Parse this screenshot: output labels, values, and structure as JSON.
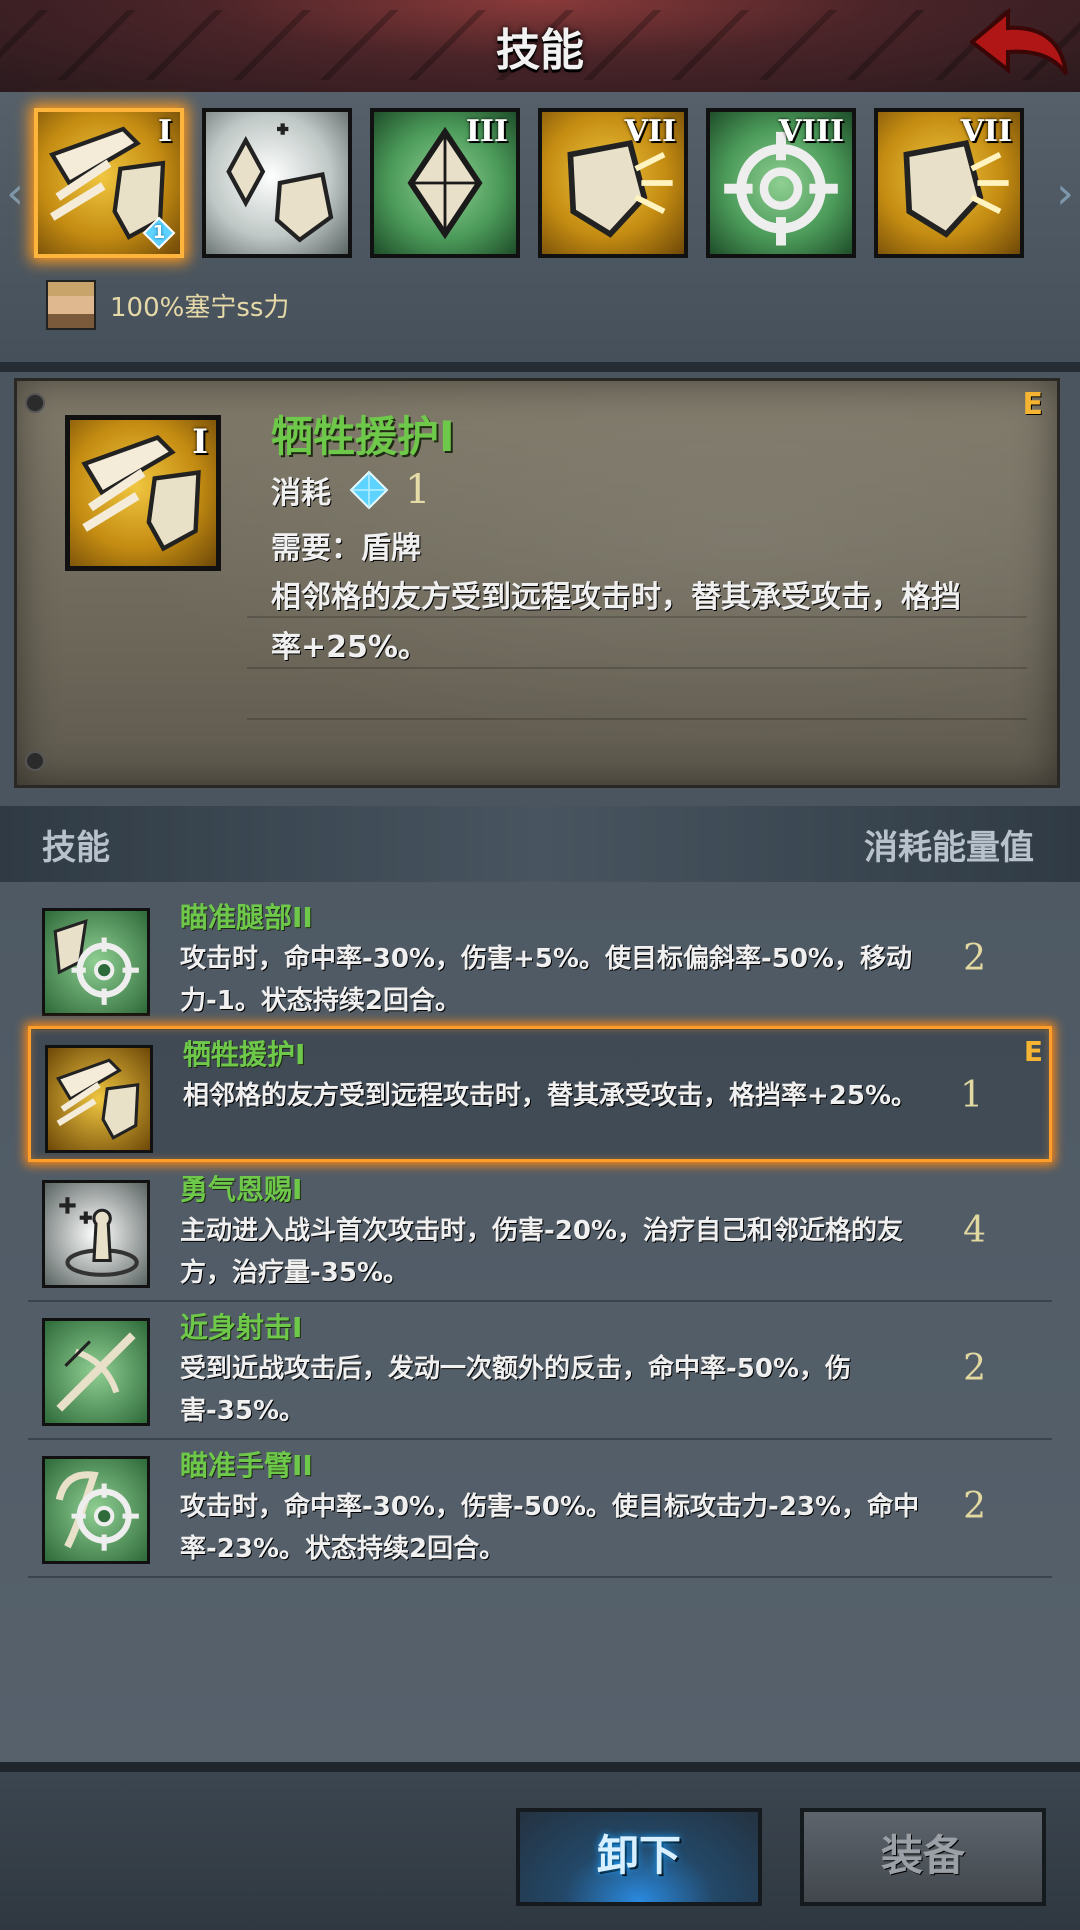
{
  "header": {
    "title": "技能"
  },
  "tray": {
    "slots": [
      {
        "icon": "shield-sacrifice-icon",
        "numeral": "I",
        "badge": "1",
        "style": "gold",
        "selected": true
      },
      {
        "icon": "crystal-shield-icon",
        "numeral": "",
        "style": "white",
        "selected": false
      },
      {
        "icon": "crystal-icon",
        "numeral": "III",
        "style": "green",
        "selected": false
      },
      {
        "icon": "shield-break-icon",
        "numeral": "VII",
        "style": "gold",
        "selected": false
      },
      {
        "icon": "crosshair-icon",
        "numeral": "VIII",
        "style": "green",
        "selected": false
      },
      {
        "icon": "shield-break-icon",
        "numeral": "VII",
        "style": "gold",
        "selected": false
      }
    ],
    "owner_text": "100%塞宁ss力"
  },
  "detail": {
    "name": "牺牲援护I",
    "tier": "E",
    "cost_label": "消耗",
    "cost_value": "1",
    "requirement": "需要：盾牌",
    "description": "相邻格的友方受到远程攻击时，替其承受攻击，格挡率+25%。"
  },
  "list_header": {
    "left": "技能",
    "right": "消耗能量值"
  },
  "skills": [
    {
      "name": "瞄准腿部II",
      "desc": "攻击时，命中率-30%，伤害+5%。使目标偏斜率-50%，移动力-1。状态持续2回合。",
      "cost": "2",
      "tier": "",
      "icon": "aim-leg-icon"
    },
    {
      "name": "牺牲援护I",
      "desc": "相邻格的友方受到远程攻击时，替其承受攻击，格挡率+25%。",
      "cost": "1",
      "tier": "E",
      "icon": "shield-sacrifice-icon"
    },
    {
      "name": "勇气恩赐I",
      "desc": "主动进入战斗首次攻击时，伤害-20%，治疗自己和邻近格的友方，治疗量-35%。",
      "cost": "4",
      "tier": "",
      "icon": "healing-icon"
    },
    {
      "name": "近身射击I",
      "desc": "受到近战攻击后，发动一次额外的反击，命中率-50%，伤害-35%。",
      "cost": "2",
      "tier": "",
      "icon": "crossbow-icon"
    },
    {
      "name": "瞄准手臂II",
      "desc": "攻击时，命中率-30%，伤害-50%。使目标攻击力-23%，命中率-23%。状态持续2回合。",
      "cost": "2",
      "tier": "",
      "icon": "aim-arm-icon"
    }
  ],
  "footer": {
    "unequip_label": "卸下",
    "equip_label": "装备"
  },
  "colors": {
    "skill_name": "#6ec84a",
    "selection": "#ff9e28",
    "tier": "#f5b431"
  }
}
